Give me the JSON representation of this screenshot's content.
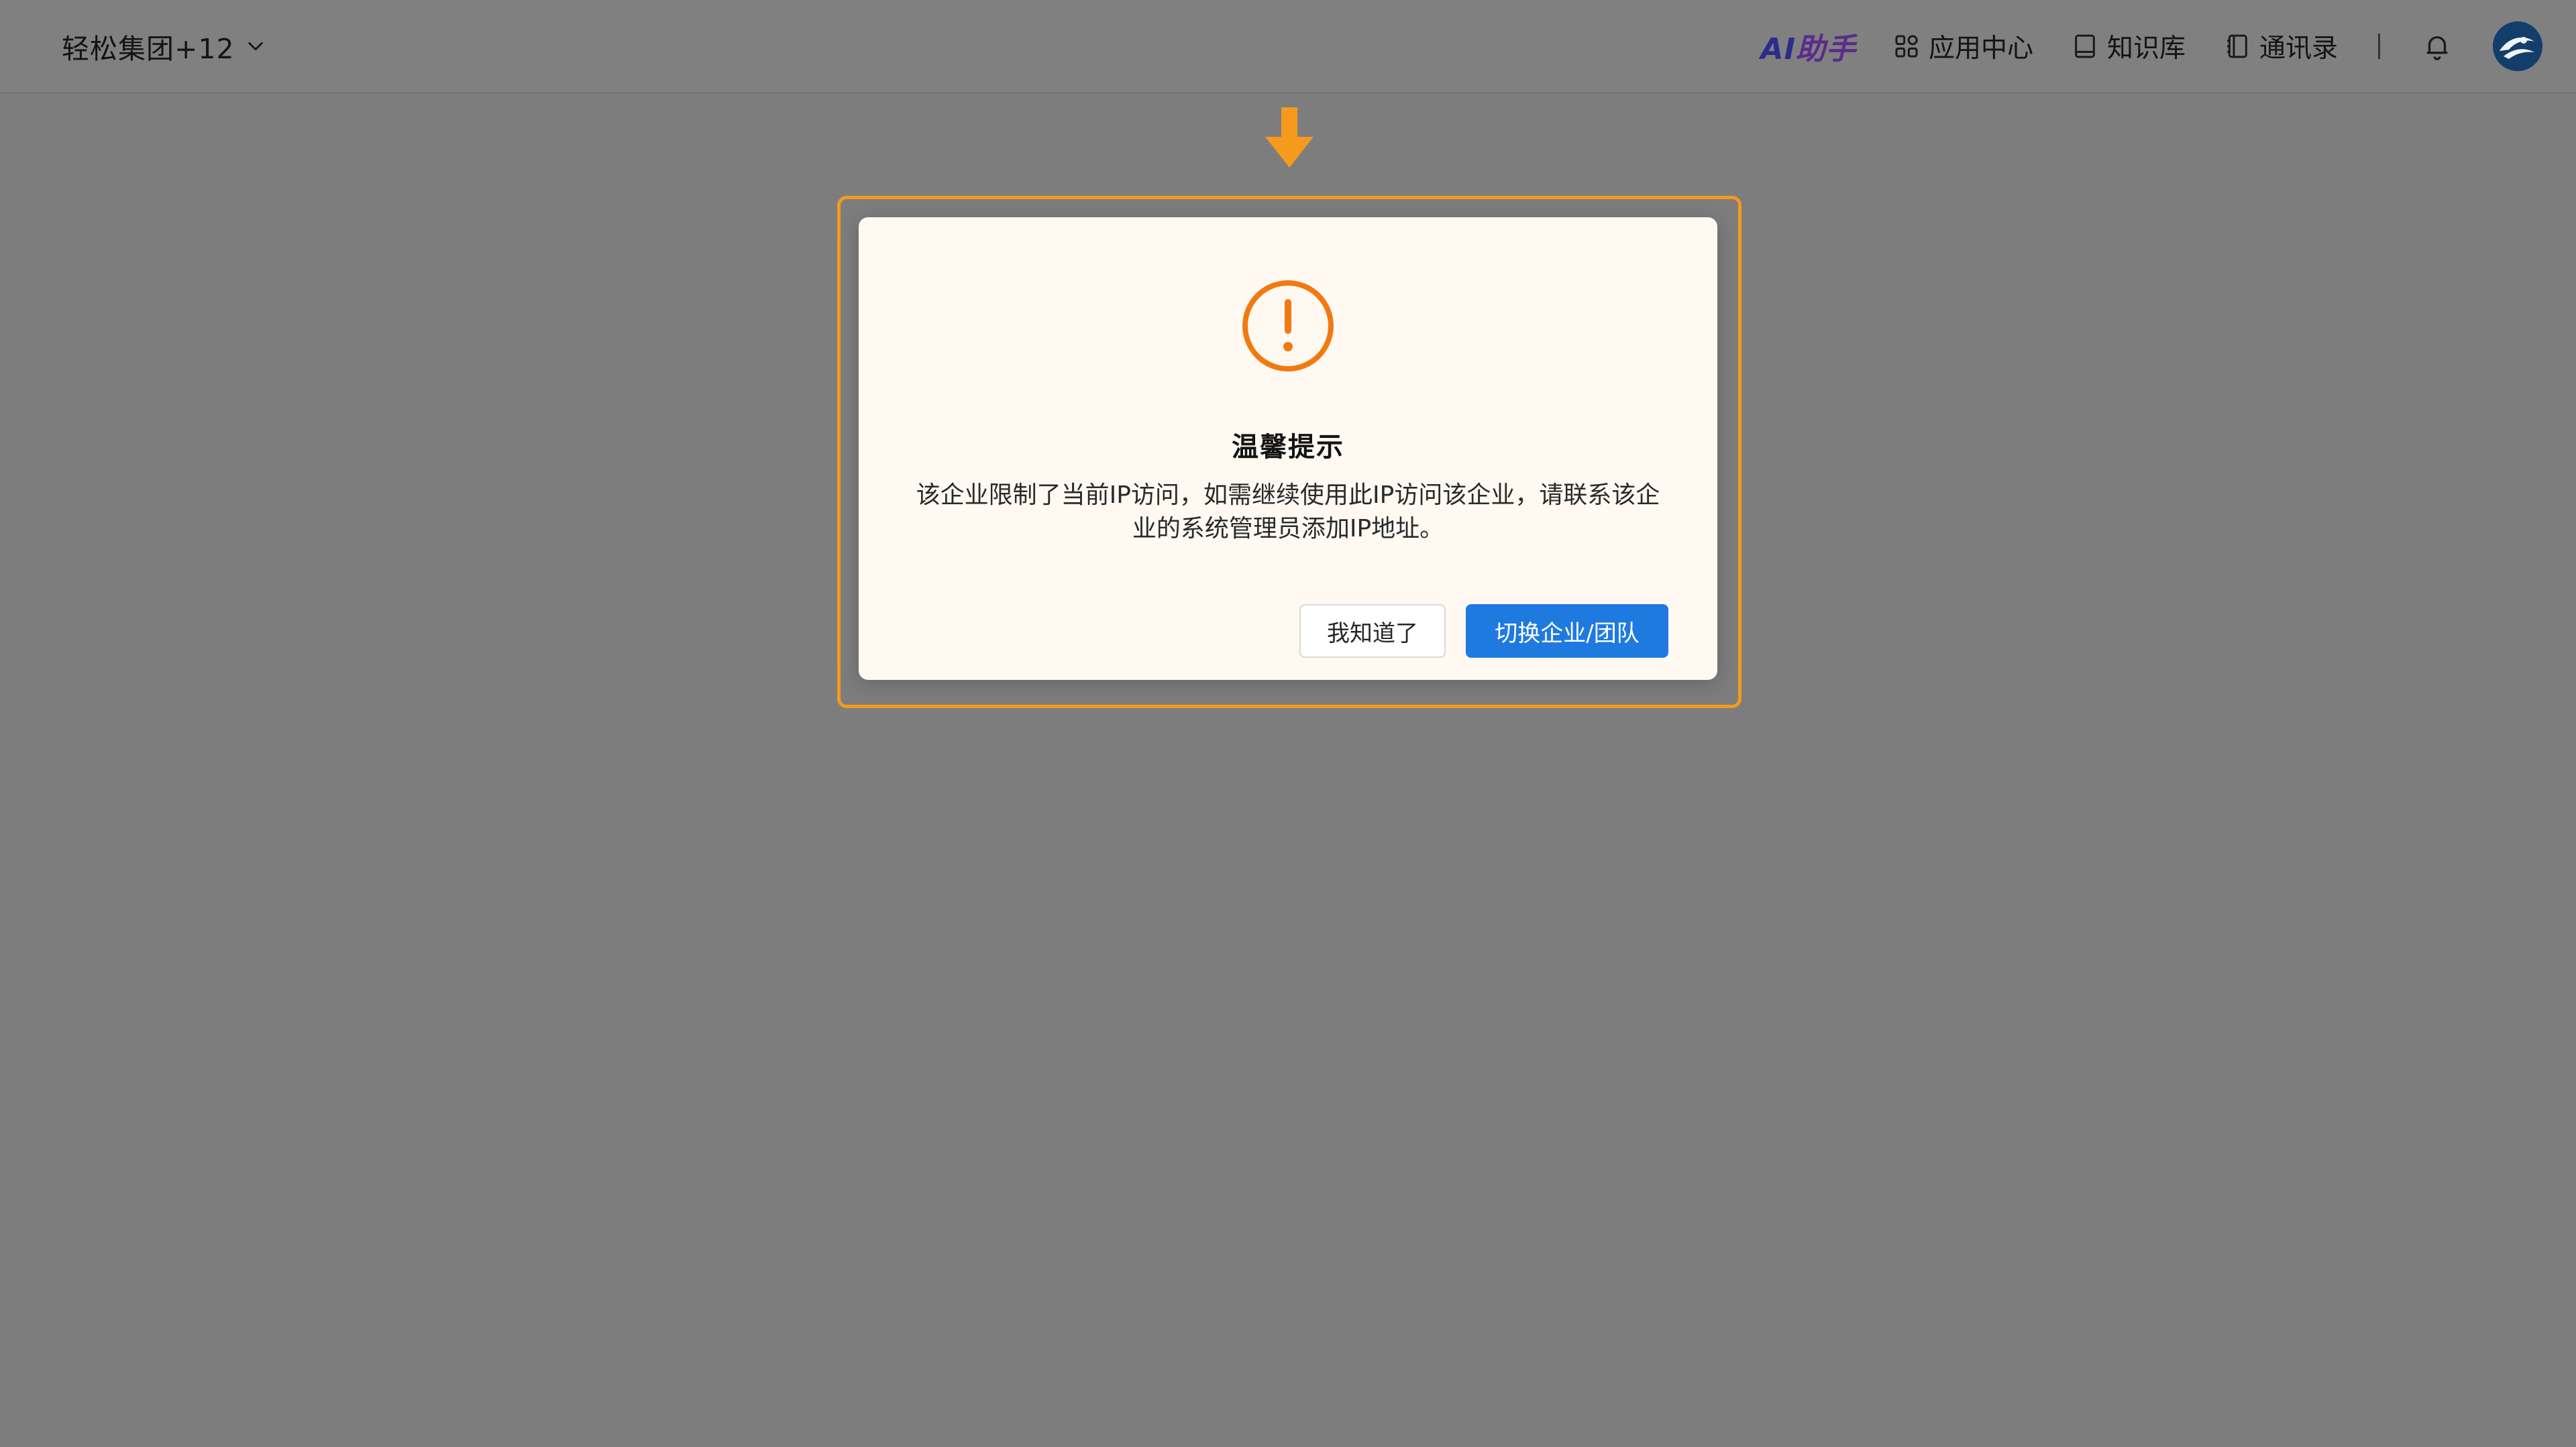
{
  "header": {
    "org_name": "轻松集团+12",
    "ai_logo": {
      "ai": "AI",
      "helper": "助手"
    },
    "nav": [
      {
        "label": "应用中心",
        "icon": "apps-grid-icon"
      },
      {
        "label": "知识库",
        "icon": "book-icon"
      },
      {
        "label": "通讯录",
        "icon": "contacts-icon"
      }
    ],
    "bell_icon": "bell-icon",
    "avatar_icon": "avatar"
  },
  "dialog": {
    "icon": "warning-circle-icon",
    "title": "温馨提示",
    "message": "该企业限制了当前IP访问，如需继续使用此IP访问该企业，请联系该企业的系统管理员添加IP地址。",
    "buttons": {
      "acknowledge": "我知道了",
      "switch": "切换企业/团队"
    }
  },
  "colors": {
    "accent_orange": "#f59a1c",
    "primary_blue": "#1f7ae0",
    "overlay_gray": "#7d7d7d"
  }
}
